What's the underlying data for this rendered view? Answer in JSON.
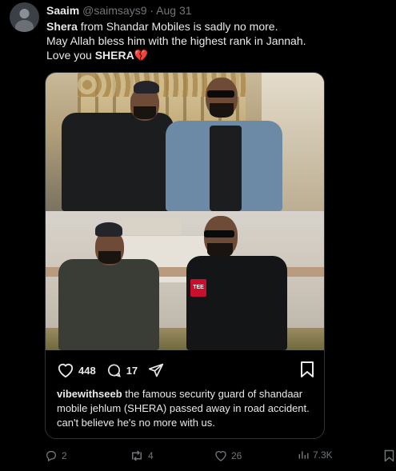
{
  "tweet": {
    "author_name": "Saaim",
    "author_handle": "@saimsays9",
    "separator": "·",
    "date": "Aug 31",
    "line1_bold": "Shera",
    "line1_rest": " from Shandar Mobiles is sadly no more.",
    "line2": "May Allah bless him with the highest rank in Jannah.",
    "line3_start": "Love you ",
    "line3_bold": "SHERA",
    "emoji": "💔"
  },
  "embedded_post": {
    "likes": "448",
    "comments": "17",
    "caption_user": "vibewithseeb",
    "caption_text": " the famous security guard of shandaar mobile jehlum (SHERA) passed away in road accident. can't believe he's no more with us.",
    "mug_label": "TEE"
  },
  "footer": {
    "replies": "2",
    "retweets": "4",
    "likes": "26",
    "views": "7.3K"
  },
  "icons": {
    "reply": "reply-icon",
    "retweet": "retweet-icon",
    "like": "heart-icon",
    "views": "views-icon",
    "bookmark": "bookmark-icon",
    "heart": "heart-icon",
    "comment": "comment-icon",
    "share": "share-icon"
  },
  "colors": {
    "background": "#000000",
    "text": "#e7e9ea",
    "muted": "#71767b",
    "border": "#2f3336",
    "broken_heart": "#e0245e"
  }
}
